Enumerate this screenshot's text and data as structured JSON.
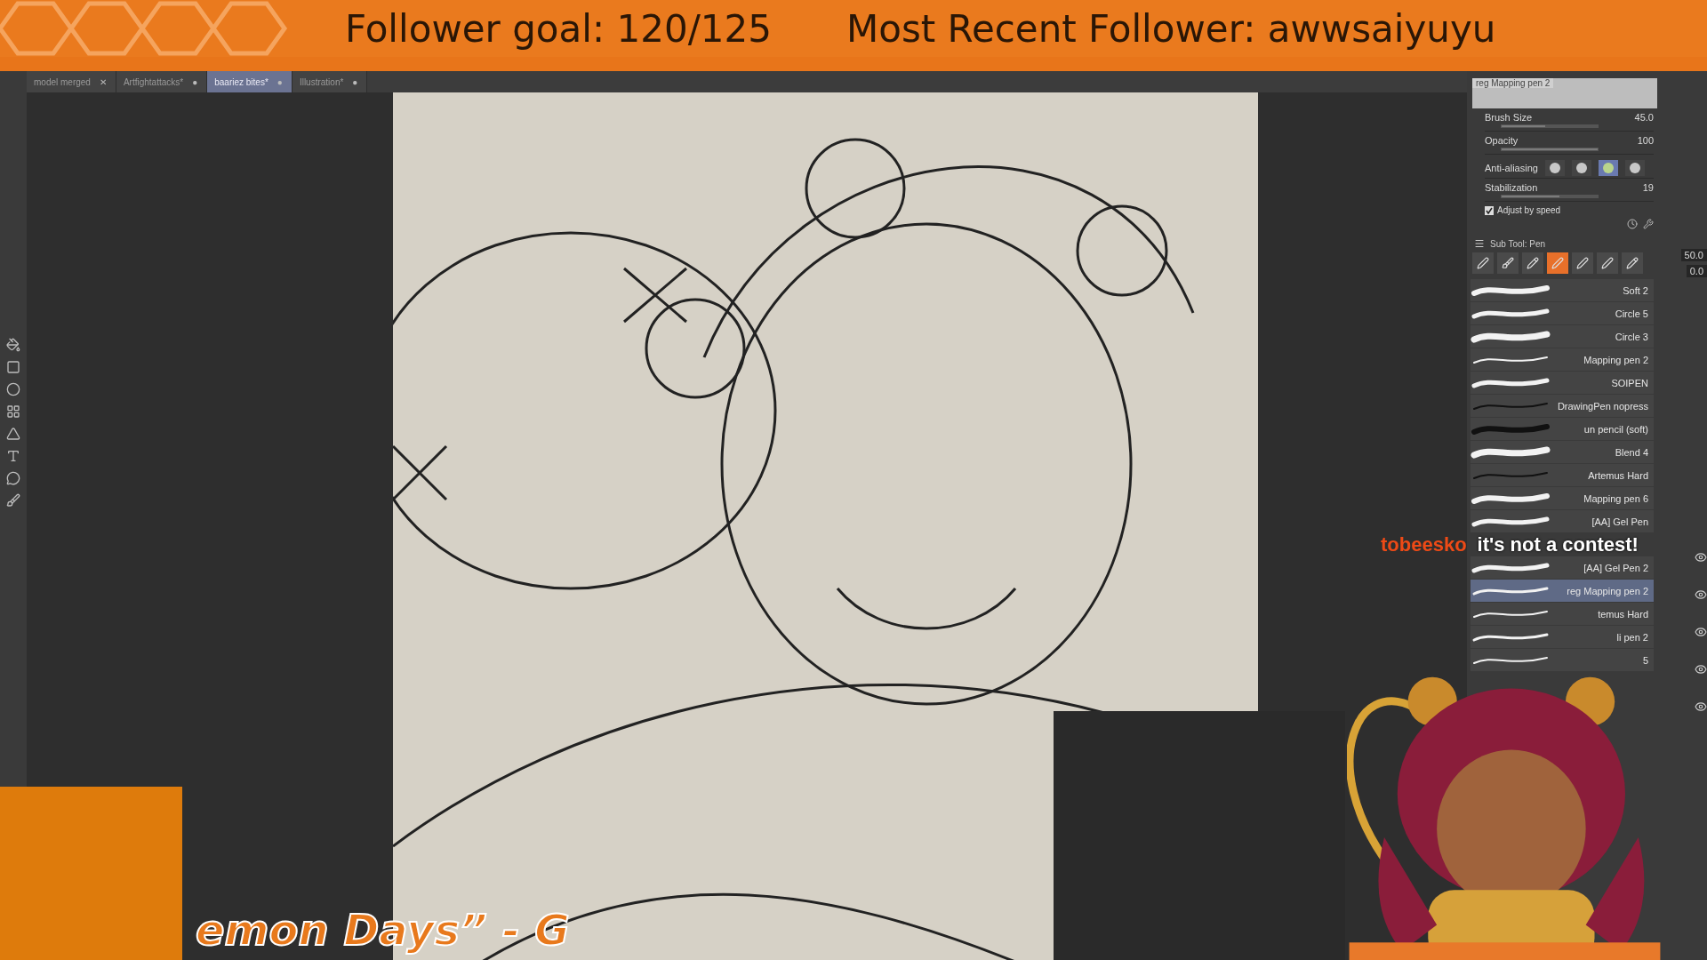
{
  "overlay": {
    "follower_goal": "Follower goal: 120/125",
    "recent_follower": "Most Recent Follower: awwsaiyuyu",
    "song_title": "emon Days”  -  G"
  },
  "tabs": [
    {
      "label": "model merged",
      "selected": false,
      "close": "✕"
    },
    {
      "label": "Artfightattacks*",
      "selected": false,
      "close": "●"
    },
    {
      "label": "baariez bites*",
      "selected": true,
      "close": "●"
    },
    {
      "label": "Illustration*",
      "selected": false,
      "close": "●"
    }
  ],
  "canvas": {
    "kind": "picture"
  },
  "tool_property": {
    "brush_name": "reg Mapping pen 2",
    "brush_size": {
      "label": "Brush Size",
      "value": "45.0",
      "level": 0.45
    },
    "opacity": {
      "label": "Opacity",
      "value": "100",
      "level": 1.0
    },
    "anti_aliasing": {
      "label": "Anti-aliasing",
      "options": [
        {
          "selected": false
        },
        {
          "selected": false
        },
        {
          "selected": true
        },
        {
          "selected": false
        }
      ]
    },
    "stabilization": {
      "label": "Stabilization",
      "value": "19",
      "level": 0.6
    },
    "adjust_by_speed": {
      "label": "Adjust by speed",
      "checked": true
    }
  },
  "sub_tool": {
    "title": "Sub Tool: Pen",
    "groups": [
      {
        "selected": false
      },
      {
        "selected": false
      },
      {
        "selected": false
      },
      {
        "selected": true
      },
      {
        "selected": false
      },
      {
        "selected": false
      },
      {
        "selected": false
      }
    ],
    "items": [
      {
        "label": "Soft 2",
        "selected": false
      },
      {
        "label": "Circle 5",
        "selected": false
      },
      {
        "label": "Circle 3",
        "selected": false
      },
      {
        "label": "Mapping pen 2",
        "selected": false
      },
      {
        "label": "SOIPEN",
        "selected": false
      },
      {
        "label": "DrawingPen nopress",
        "selected": false
      },
      {
        "label": "un pencil (soft)",
        "selected": false
      },
      {
        "label": "Blend 4",
        "selected": false
      },
      {
        "label": "Artemus Hard",
        "selected": false
      },
      {
        "label": "Mapping pen 6",
        "selected": false
      },
      {
        "label": "[AA] Gel Pen",
        "selected": false
      },
      {
        "kind": "covered"
      },
      {
        "label": "[AA] Gel Pen 2",
        "selected": false
      },
      {
        "label": "reg Mapping pen 2",
        "selected": true
      },
      {
        "label": "temus Hard",
        "selected": false
      },
      {
        "label": "li pen 2",
        "selected": false
      },
      {
        "label": "5",
        "selected": false
      }
    ]
  },
  "side_values": [
    "50.0",
    "0.0"
  ],
  "chat": {
    "user": "tobeesko",
    "message": "it's not a contest!"
  },
  "avatar": {
    "kind": "picture"
  }
}
